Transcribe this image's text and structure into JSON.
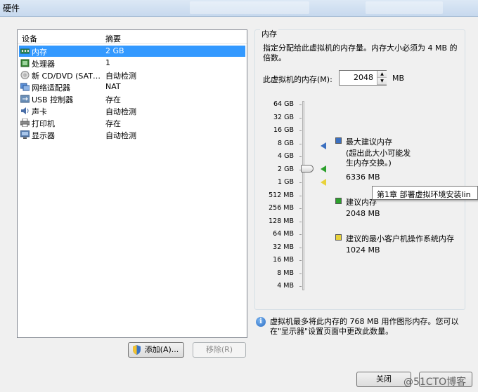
{
  "window": {
    "title": "硬件"
  },
  "device_list": {
    "columns": [
      "设备",
      "摘要"
    ],
    "rows": [
      {
        "name": "内存",
        "summary": "2 GB",
        "icon": "memory-icon"
      },
      {
        "name": "处理器",
        "summary": "1",
        "icon": "processor-icon"
      },
      {
        "name": "新 CD/DVD (SAT…",
        "summary": "自动检测",
        "icon": "cd-icon"
      },
      {
        "name": "网络适配器",
        "summary": "NAT",
        "icon": "network-icon"
      },
      {
        "name": "USB 控制器",
        "summary": "存在",
        "icon": "usb-icon"
      },
      {
        "name": "声卡",
        "summary": "自动检测",
        "icon": "sound-icon"
      },
      {
        "name": "打印机",
        "summary": "存在",
        "icon": "printer-icon"
      },
      {
        "name": "显示器",
        "summary": "自动检测",
        "icon": "display-icon"
      }
    ],
    "selected_index": 0
  },
  "buttons": {
    "add": "添加(A)...",
    "remove": "移除(R)",
    "close": "关闭"
  },
  "memory": {
    "section_title": "内存",
    "description": "指定分配给此虚拟机的内存量。内存大小必须为 4 MB 的倍数。",
    "field_label": "此虚拟机的内存(M):",
    "value": "2048",
    "unit": "MB",
    "scale": [
      "64 GB",
      "32 GB",
      "16 GB",
      "8 GB",
      "4 GB",
      "2 GB",
      "1 GB",
      "512 MB",
      "256 MB",
      "128 MB",
      "64 MB",
      "32 MB",
      "16 MB",
      "8 MB",
      "4 MB"
    ],
    "legend": {
      "max_title": "最大建议内存",
      "max_note": "(超出此大小可能发生内存交换。)",
      "max_value": "6336 MB",
      "rec_title": "建议内存",
      "rec_value": "2048 MB",
      "min_title": "建议的最小客户机操作系统内存",
      "min_value": "1024 MB"
    },
    "colors": {
      "max": "#3a6fc0",
      "rec": "#2ca02c",
      "min": "#e8d23a"
    },
    "info": "虚拟机最多将此内存的 768 MB 用作图形内存。您可以在\"显示器\"设置页面中更改此数量。"
  },
  "tooltip": "第1章 部署虚拟环境安装lin",
  "watermark": "@51CTO博客"
}
